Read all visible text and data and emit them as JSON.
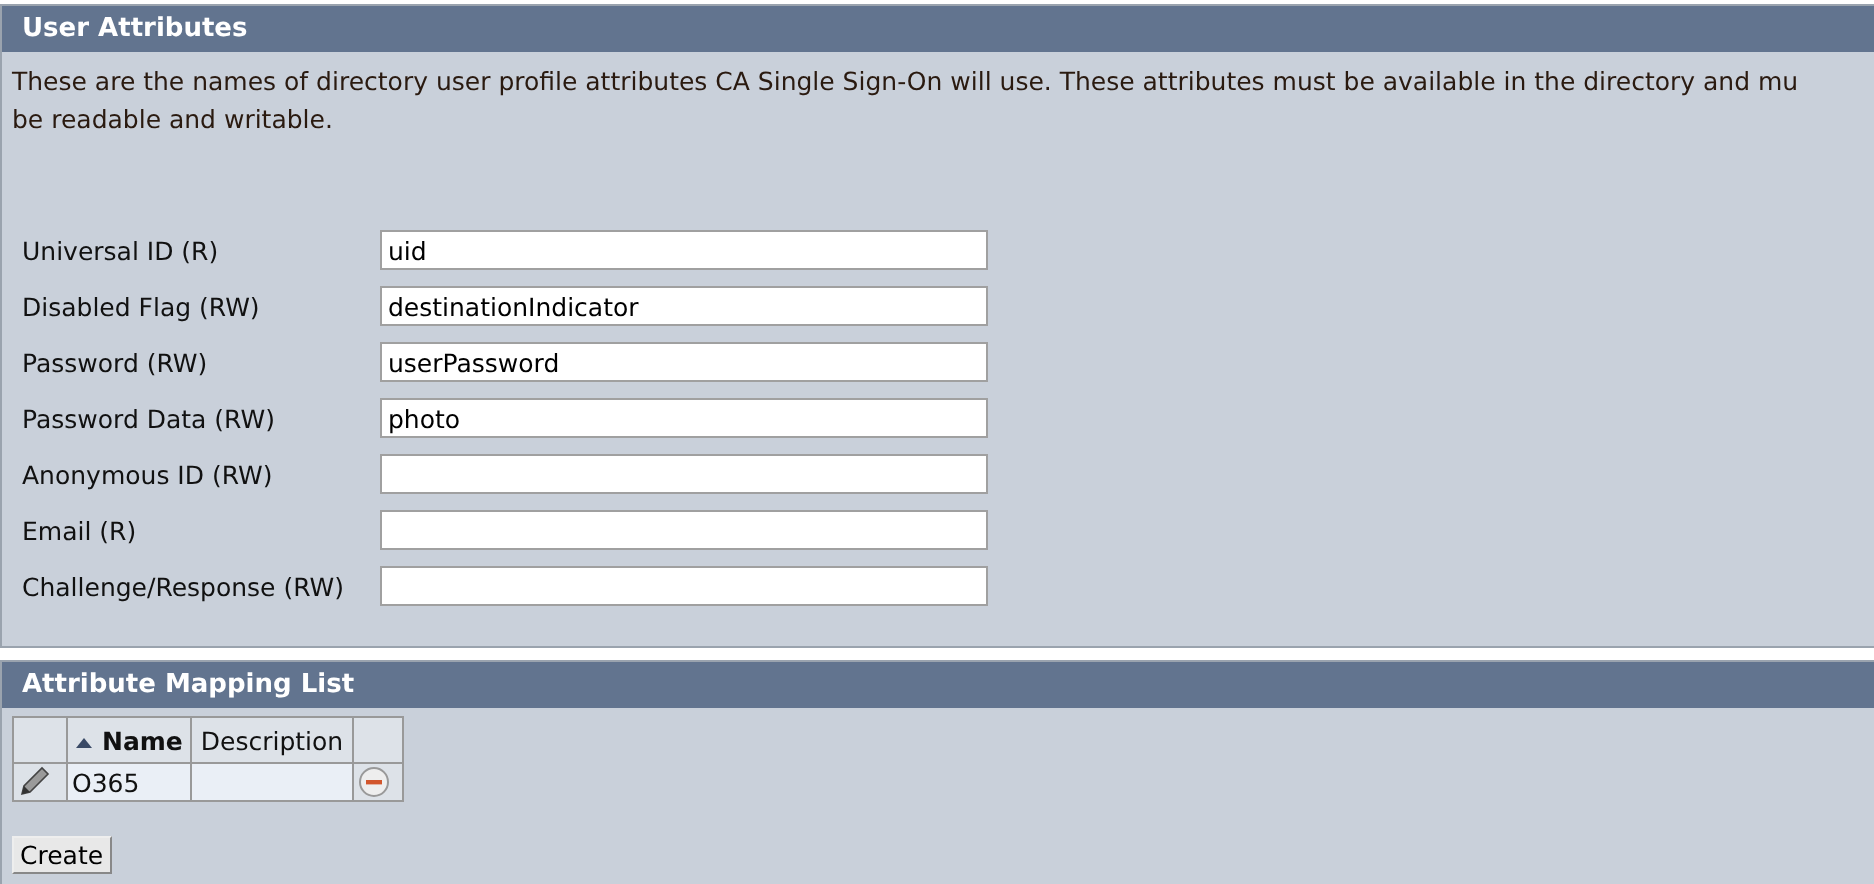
{
  "user_attributes": {
    "title": "User Attributes",
    "description_lines": [
      "These are the names of directory user profile attributes CA Single Sign-On will use. These attributes must be available in the directory and mu",
      "be readable and writable."
    ],
    "fields": [
      {
        "label": "Universal ID (R)",
        "value": "uid"
      },
      {
        "label": "Disabled Flag (RW)",
        "value": "destinationIndicator"
      },
      {
        "label": "Password (RW)",
        "value": "userPassword"
      },
      {
        "label": "Password Data (RW)",
        "value": "photo"
      },
      {
        "label": "Anonymous ID (RW)"
      },
      {
        "label": "Email (R)"
      },
      {
        "label": "Challenge/Response (RW)"
      }
    ]
  },
  "attribute_mapping_list": {
    "title": "Attribute Mapping List",
    "columns": [
      "Name",
      "Description"
    ],
    "rows": [
      {
        "name": "O365"
      }
    ],
    "create_button": "Create"
  }
}
